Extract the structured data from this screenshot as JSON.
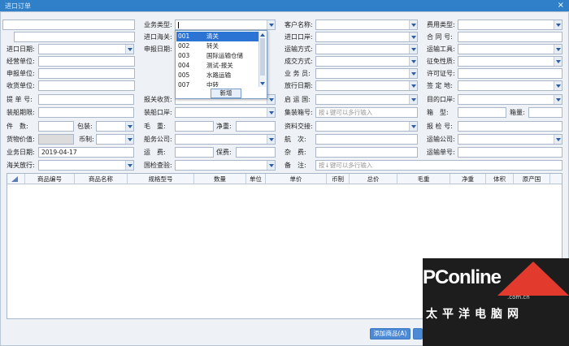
{
  "window": {
    "title": "进口订单",
    "close": "×"
  },
  "labels": {
    "business_type": "业务类型:",
    "customer_name": "客户名称:",
    "fee_type": "费用类型:",
    "import_customs": "进口海关:",
    "import_port": "进口口岸:",
    "contract_no": "合 同 号:",
    "import_date": "进口日期:",
    "declare_date": "申报日期:",
    "transport_mode": "运输方式:",
    "transport_tool": "运输工具:",
    "operating_unit": "经营单位:",
    "deal_mode": "成交方式:",
    "tax_nature": "征免性质:",
    "declare_unit": "申报单位:",
    "salesman": "业 务 员:",
    "license_no": "许可证号:",
    "receiving_unit": "收货单位:",
    "release_date": "放行日期:",
    "sign_place": "签 定 地:",
    "bill_no": "提 单 号:",
    "customs_receipt": "报关收货:",
    "departure_country": "启 运 国:",
    "dest_port": "目的口岸:",
    "loading_deadline": "装船期限:",
    "loading_port": "装船口岸:",
    "container_no": "集装箱号:",
    "box_type": "箱　型:",
    "box_count": "箱量:",
    "pieces": "件　数:",
    "packing": "包装:",
    "gross_weight": "毛　重:",
    "net_weight": "净重:",
    "document_exchange": "资料交接:",
    "inspection_no": "报 检 号:",
    "goods_value": "货物价值:",
    "currency": "币制:",
    "shipping_company": "船务公司:",
    "voyage": "航　次:",
    "transport_company": "运输公司:",
    "business_date": "业务日期:",
    "freight": "运　费:",
    "insurance": "保费:",
    "misc_fee": "杂　费:",
    "transport_order_no": "运输单号:",
    "customs_release": "海关放行:",
    "ciq_inspection": "国检查验:",
    "remarks": "备　注:"
  },
  "values": {
    "business_date": "2019-04-17",
    "container_placeholder": "按↓键可以多行输入",
    "remarks_placeholder": "按↓键可以多行输入"
  },
  "dropdown": {
    "items": [
      {
        "code": "001",
        "name": "清关"
      },
      {
        "code": "002",
        "name": "转关"
      },
      {
        "code": "003",
        "name": "国际运输仓储"
      },
      {
        "code": "004",
        "name": "测试-报关"
      },
      {
        "code": "005",
        "name": "水路运输"
      },
      {
        "code": "007",
        "name": "中转"
      }
    ],
    "new_button": "新增"
  },
  "grid": {
    "columns": [
      "商品编号",
      "商品名称",
      "规格型号",
      "数量",
      "单位",
      "单价",
      "币制",
      "总价",
      "毛重",
      "净重",
      "体积",
      "原产国"
    ]
  },
  "buttons": {
    "add_goods": "添加商品(A)"
  },
  "watermark": {
    "brand": "PConline",
    "domain": ".com.cn",
    "cn": "太平洋电脑网"
  }
}
